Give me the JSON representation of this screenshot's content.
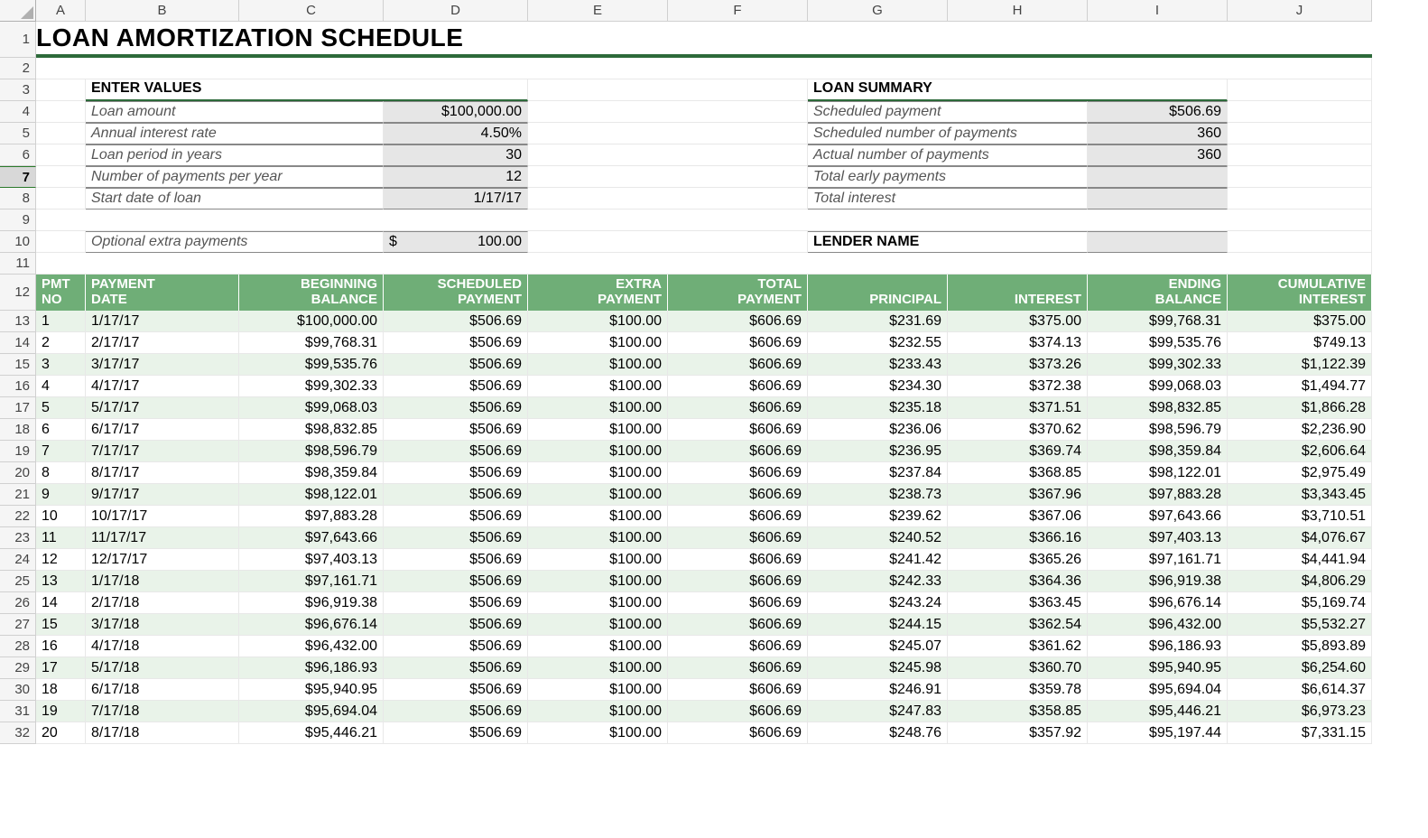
{
  "columns": [
    "A",
    "B",
    "C",
    "D",
    "E",
    "F",
    "G",
    "H",
    "I",
    "J"
  ],
  "title": "LOAN AMORTIZATION SCHEDULE",
  "enter_values_label": "ENTER VALUES",
  "loan_summary_label": "LOAN SUMMARY",
  "inputs": {
    "loan_amount_label": "Loan amount",
    "loan_amount": "$100,000.00",
    "air_label": "Annual interest rate",
    "air": "4.50%",
    "period_label": "Loan period in years",
    "period": "30",
    "npy_label": "Number of payments per year",
    "npy": "12",
    "start_label": "Start date of loan",
    "start": "1/17/17",
    "extra_label": "Optional extra payments",
    "extra_currency": "$",
    "extra": "100.00"
  },
  "summary": {
    "sched_pay_label": "Scheduled payment",
    "sched_pay": "$506.69",
    "sched_num_label": "Scheduled number of payments",
    "sched_num": "360",
    "actual_num_label": "Actual number of payments",
    "actual_num": "360",
    "early_label": "Total early payments",
    "early": "",
    "ti_label": "Total interest",
    "ti": "",
    "lender_label": "LENDER NAME",
    "lender": ""
  },
  "headers": {
    "pmt_no": "PMT\nNO",
    "pmt_date": "PAYMENT\nDATE",
    "beg_bal": "BEGINNING\nBALANCE",
    "sched": "SCHEDULED\nPAYMENT",
    "extra": "EXTRA\nPAYMENT",
    "total": "TOTAL\nPAYMENT",
    "principal": "PRINCIPAL",
    "interest": "INTEREST",
    "end_bal": "ENDING\nBALANCE",
    "cum_int": "CUMULATIVE\nINTEREST"
  },
  "rows": [
    {
      "n": "1",
      "d": "1/17/17",
      "bb": "$100,000.00",
      "sp": "$506.69",
      "ep": "$100.00",
      "tp": "$606.69",
      "pr": "$231.69",
      "in": "$375.00",
      "eb": "$99,768.31",
      "ci": "$375.00"
    },
    {
      "n": "2",
      "d": "2/17/17",
      "bb": "$99,768.31",
      "sp": "$506.69",
      "ep": "$100.00",
      "tp": "$606.69",
      "pr": "$232.55",
      "in": "$374.13",
      "eb": "$99,535.76",
      "ci": "$749.13"
    },
    {
      "n": "3",
      "d": "3/17/17",
      "bb": "$99,535.76",
      "sp": "$506.69",
      "ep": "$100.00",
      "tp": "$606.69",
      "pr": "$233.43",
      "in": "$373.26",
      "eb": "$99,302.33",
      "ci": "$1,122.39"
    },
    {
      "n": "4",
      "d": "4/17/17",
      "bb": "$99,302.33",
      "sp": "$506.69",
      "ep": "$100.00",
      "tp": "$606.69",
      "pr": "$234.30",
      "in": "$372.38",
      "eb": "$99,068.03",
      "ci": "$1,494.77"
    },
    {
      "n": "5",
      "d": "5/17/17",
      "bb": "$99,068.03",
      "sp": "$506.69",
      "ep": "$100.00",
      "tp": "$606.69",
      "pr": "$235.18",
      "in": "$371.51",
      "eb": "$98,832.85",
      "ci": "$1,866.28"
    },
    {
      "n": "6",
      "d": "6/17/17",
      "bb": "$98,832.85",
      "sp": "$506.69",
      "ep": "$100.00",
      "tp": "$606.69",
      "pr": "$236.06",
      "in": "$370.62",
      "eb": "$98,596.79",
      "ci": "$2,236.90"
    },
    {
      "n": "7",
      "d": "7/17/17",
      "bb": "$98,596.79",
      "sp": "$506.69",
      "ep": "$100.00",
      "tp": "$606.69",
      "pr": "$236.95",
      "in": "$369.74",
      "eb": "$98,359.84",
      "ci": "$2,606.64"
    },
    {
      "n": "8",
      "d": "8/17/17",
      "bb": "$98,359.84",
      "sp": "$506.69",
      "ep": "$100.00",
      "tp": "$606.69",
      "pr": "$237.84",
      "in": "$368.85",
      "eb": "$98,122.01",
      "ci": "$2,975.49"
    },
    {
      "n": "9",
      "d": "9/17/17",
      "bb": "$98,122.01",
      "sp": "$506.69",
      "ep": "$100.00",
      "tp": "$606.69",
      "pr": "$238.73",
      "in": "$367.96",
      "eb": "$97,883.28",
      "ci": "$3,343.45"
    },
    {
      "n": "10",
      "d": "10/17/17",
      "bb": "$97,883.28",
      "sp": "$506.69",
      "ep": "$100.00",
      "tp": "$606.69",
      "pr": "$239.62",
      "in": "$367.06",
      "eb": "$97,643.66",
      "ci": "$3,710.51"
    },
    {
      "n": "11",
      "d": "11/17/17",
      "bb": "$97,643.66",
      "sp": "$506.69",
      "ep": "$100.00",
      "tp": "$606.69",
      "pr": "$240.52",
      "in": "$366.16",
      "eb": "$97,403.13",
      "ci": "$4,076.67"
    },
    {
      "n": "12",
      "d": "12/17/17",
      "bb": "$97,403.13",
      "sp": "$506.69",
      "ep": "$100.00",
      "tp": "$606.69",
      "pr": "$241.42",
      "in": "$365.26",
      "eb": "$97,161.71",
      "ci": "$4,441.94"
    },
    {
      "n": "13",
      "d": "1/17/18",
      "bb": "$97,161.71",
      "sp": "$506.69",
      "ep": "$100.00",
      "tp": "$606.69",
      "pr": "$242.33",
      "in": "$364.36",
      "eb": "$96,919.38",
      "ci": "$4,806.29"
    },
    {
      "n": "14",
      "d": "2/17/18",
      "bb": "$96,919.38",
      "sp": "$506.69",
      "ep": "$100.00",
      "tp": "$606.69",
      "pr": "$243.24",
      "in": "$363.45",
      "eb": "$96,676.14",
      "ci": "$5,169.74"
    },
    {
      "n": "15",
      "d": "3/17/18",
      "bb": "$96,676.14",
      "sp": "$506.69",
      "ep": "$100.00",
      "tp": "$606.69",
      "pr": "$244.15",
      "in": "$362.54",
      "eb": "$96,432.00",
      "ci": "$5,532.27"
    },
    {
      "n": "16",
      "d": "4/17/18",
      "bb": "$96,432.00",
      "sp": "$506.69",
      "ep": "$100.00",
      "tp": "$606.69",
      "pr": "$245.07",
      "in": "$361.62",
      "eb": "$96,186.93",
      "ci": "$5,893.89"
    },
    {
      "n": "17",
      "d": "5/17/18",
      "bb": "$96,186.93",
      "sp": "$506.69",
      "ep": "$100.00",
      "tp": "$606.69",
      "pr": "$245.98",
      "in": "$360.70",
      "eb": "$95,940.95",
      "ci": "$6,254.60"
    },
    {
      "n": "18",
      "d": "6/17/18",
      "bb": "$95,940.95",
      "sp": "$506.69",
      "ep": "$100.00",
      "tp": "$606.69",
      "pr": "$246.91",
      "in": "$359.78",
      "eb": "$95,694.04",
      "ci": "$6,614.37"
    },
    {
      "n": "19",
      "d": "7/17/18",
      "bb": "$95,694.04",
      "sp": "$506.69",
      "ep": "$100.00",
      "tp": "$606.69",
      "pr": "$247.83",
      "in": "$358.85",
      "eb": "$95,446.21",
      "ci": "$6,973.23"
    },
    {
      "n": "20",
      "d": "8/17/18",
      "bb": "$95,446.21",
      "sp": "$506.69",
      "ep": "$100.00",
      "tp": "$606.69",
      "pr": "$248.76",
      "in": "$357.92",
      "eb": "$95,197.44",
      "ci": "$7,331.15"
    }
  ]
}
